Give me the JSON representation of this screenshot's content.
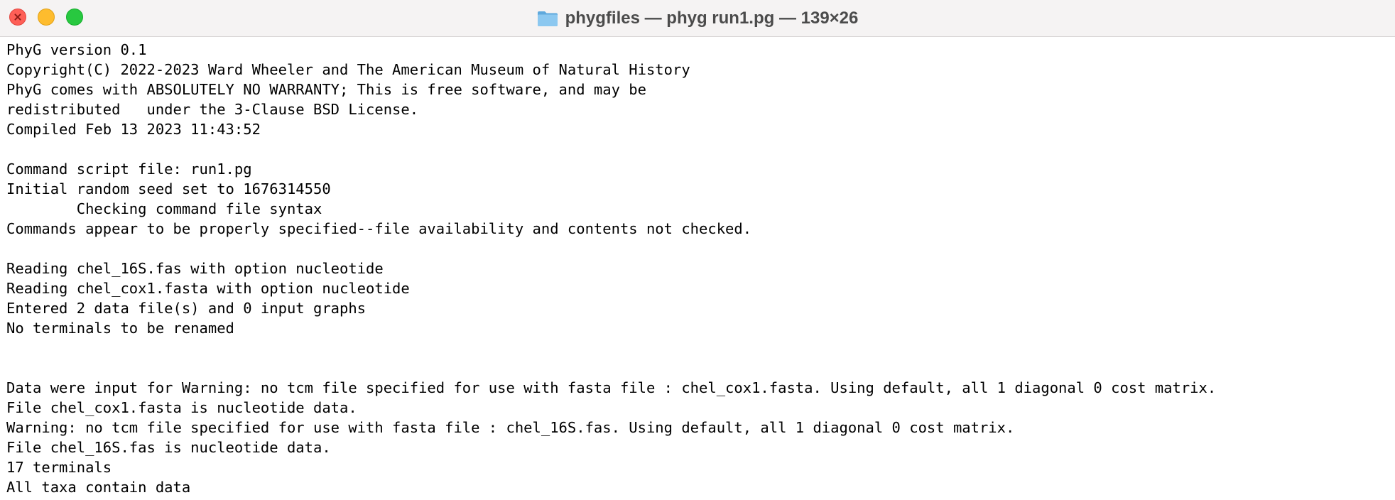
{
  "window": {
    "title": "phygfiles — phyg run1.pg — 139×26",
    "folder_icon": "folder-icon",
    "colors": {
      "close": "#fe5f57",
      "minimize": "#febc2e",
      "zoom": "#28c840",
      "folder": "#7bbde8"
    }
  },
  "terminal": {
    "lines": [
      "PhyG version 0.1",
      "Copyright(C) 2022-2023 Ward Wheeler and The American Museum of Natural History",
      "PhyG comes with ABSOLUTELY NO WARRANTY; This is free software, and may be",
      "redistributed   under the 3-Clause BSD License.",
      "Compiled Feb 13 2023 11:43:52",
      "",
      "Command script file: run1.pg",
      "Initial random seed set to 1676314550",
      "        Checking command file syntax",
      "Commands appear to be properly specified--file availability and contents not checked.",
      "",
      "Reading chel_16S.fas with option nucleotide",
      "Reading chel_cox1.fasta with option nucleotide",
      "Entered 2 data file(s) and 0 input graphs",
      "No terminals to be renamed",
      "",
      "",
      "Data were input for Warning: no tcm file specified for use with fasta file : chel_cox1.fasta. Using default, all 1 diagonal 0 cost matrix.",
      "File chel_cox1.fasta is nucleotide data.",
      "Warning: no tcm file specified for use with fasta file : chel_16S.fas. Using default, all 1 diagonal 0 cost matrix.",
      "File chel_16S.fas is nucleotide data.",
      "17 terminals",
      "All taxa contain data"
    ]
  }
}
